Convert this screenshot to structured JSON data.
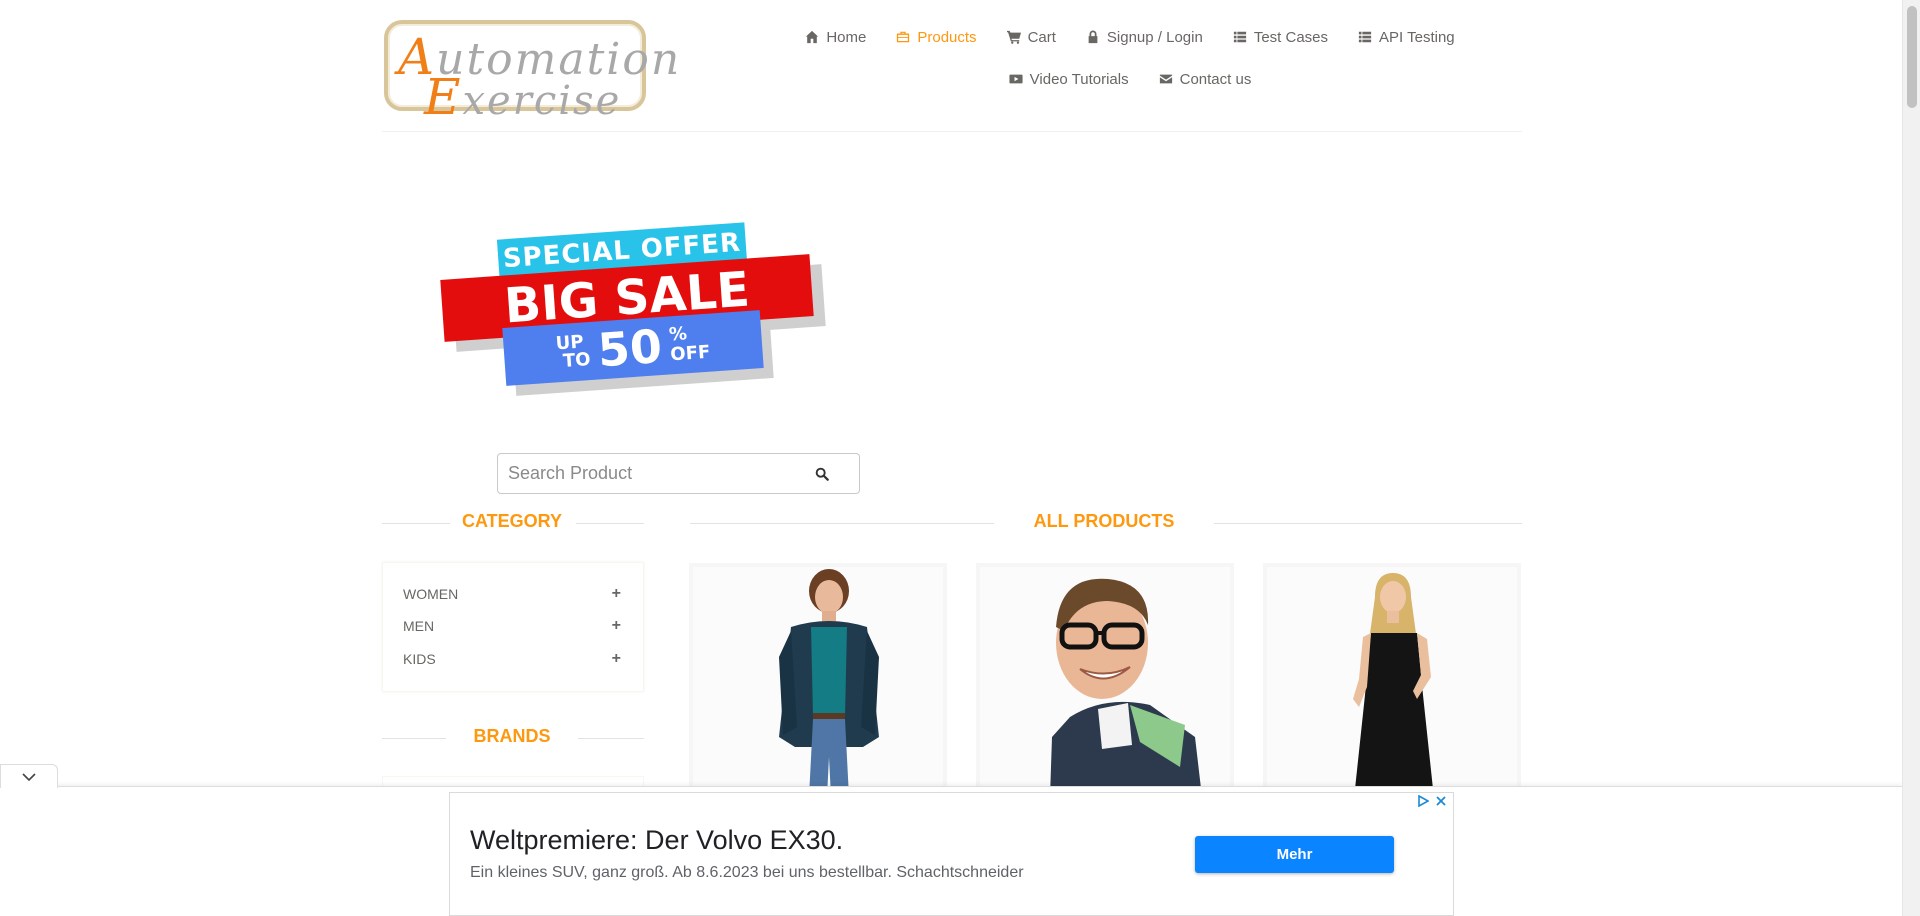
{
  "logo": {
    "line1_first": "A",
    "line1_rest": "utomation",
    "line2_first": "E",
    "line2_rest": "xercise"
  },
  "nav": [
    {
      "label": "Home",
      "icon": "home-icon",
      "active": false
    },
    {
      "label": "Products",
      "icon": "products-icon",
      "active": true
    },
    {
      "label": "Cart",
      "icon": "cart-icon",
      "active": false
    },
    {
      "label": "Signup / Login",
      "icon": "lock-icon",
      "active": false
    },
    {
      "label": "Test Cases",
      "icon": "list-icon",
      "active": false
    },
    {
      "label": "API Testing",
      "icon": "list-icon",
      "active": false
    },
    {
      "label": "Video Tutorials",
      "icon": "youtube-icon",
      "active": false
    },
    {
      "label": "Contact us",
      "icon": "envelope-icon",
      "active": false
    }
  ],
  "banner": {
    "special": "SPECIAL OFFER",
    "big": "BIG SALE",
    "up": "UP",
    "to": "TO",
    "value": "50",
    "percent": "%",
    "off": "OFF"
  },
  "search": {
    "placeholder": "Search Product",
    "value": ""
  },
  "category": {
    "title": "CATEGORY",
    "items": [
      {
        "label": "WOMEN"
      },
      {
        "label": "MEN"
      },
      {
        "label": "KIDS"
      }
    ]
  },
  "brands": {
    "title": "BRANDS"
  },
  "products": {
    "title": "ALL PRODUCTS"
  },
  "ad": {
    "headline": "Weltpremiere: Der Volvo EX30.",
    "description": "Ein kleines SUV, ganz groß. Ab 8.6.2023 bei uns bestellbar. Schachtschneider",
    "button": "Mehr"
  },
  "colors": {
    "accent": "#fe980f",
    "text": "#696763",
    "ad_button": "#0a84ff"
  }
}
